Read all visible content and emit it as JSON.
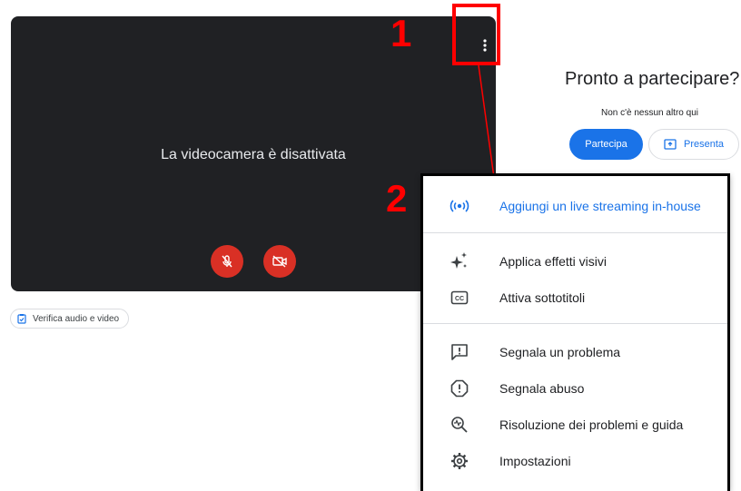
{
  "annotations": {
    "step1": "1",
    "step2": "2"
  },
  "preview": {
    "camera_off_text": "La videocamera è disattivata",
    "check_audio_video": "Verifica audio e video"
  },
  "join_panel": {
    "title": "Pronto a partecipare?",
    "nobody_here": "Non c'è nessun altro qui",
    "join_label": "Partecipa",
    "present_label": "Presenta"
  },
  "menu": {
    "items": [
      {
        "label": "Aggiungi un live streaming in-house",
        "icon": "live-stream-icon"
      },
      {
        "label": "Applica effetti visivi",
        "icon": "sparkle-icon"
      },
      {
        "label": "Attiva sottotitoli",
        "icon": "captions-icon"
      },
      {
        "label": "Segnala un problema",
        "icon": "feedback-icon"
      },
      {
        "label": "Segnala abuso",
        "icon": "report-icon"
      },
      {
        "label": "Risoluzione dei problemi e guida",
        "icon": "troubleshoot-icon"
      },
      {
        "label": "Impostazioni",
        "icon": "gear-icon"
      }
    ]
  },
  "colors": {
    "accent": "#1a73e8",
    "danger": "#d93025",
    "annotation": "#ff0000",
    "video_bg": "#202124"
  }
}
